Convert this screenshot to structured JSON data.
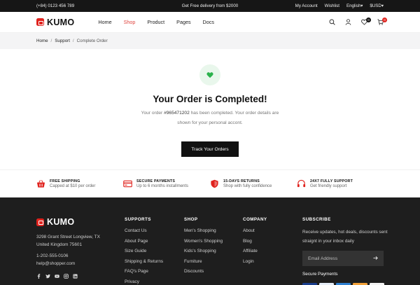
{
  "topbar": {
    "phone": "(+84) 0123 456 789",
    "promo": "Get Free delivery from $2000",
    "account": "My Account",
    "wishlist": "Wishlist",
    "language": "English▾",
    "currency": "$USD▾"
  },
  "header": {
    "logo": "KUMO",
    "nav": [
      "Home",
      "Shop",
      "Product",
      "Pages",
      "Docs"
    ],
    "active_nav": "Shop",
    "wishlist_count": "0",
    "cart_count": "0"
  },
  "breadcrumb": {
    "items": [
      "Home",
      "Support",
      "Complete Order"
    ],
    "separator": "/"
  },
  "main": {
    "title": "Your Order is Completed!",
    "desc_prefix": "Your order ",
    "order_number": "#965471202",
    "desc_suffix": " has been completed. Your order details are shown for your personal accont.",
    "button": "Track Your Orders"
  },
  "features": [
    {
      "title": "Free Shipping",
      "sub": "Capped at $10 per order",
      "icon": "basket-icon"
    },
    {
      "title": "Secure Payments",
      "sub": "Up to 6 months installments",
      "icon": "credit-card-icon"
    },
    {
      "title": "15-Days Returns",
      "sub": "Shop with fully confidence",
      "icon": "shield-icon"
    },
    {
      "title": "24x7 Fully Support",
      "sub": "Get friendly support",
      "icon": "headphones-icon"
    }
  ],
  "footer": {
    "logo": "KUMO",
    "address_line1": "3298 Grant Street Longview, TX",
    "address_line2": "United Kingdom 75601",
    "phone": "1-202-555-0106",
    "email": "help@shopper.com",
    "columns": [
      {
        "title": "Supports",
        "links": [
          "Contact Us",
          "About Page",
          "Size Guide",
          "Shipping & Returns",
          "FAQ's Page",
          "Privacy"
        ]
      },
      {
        "title": "Shop",
        "links": [
          "Men's Shopping",
          "Women's Shopping",
          "Kids's Shopping",
          "Furniture",
          "Discounts"
        ]
      },
      {
        "title": "Company",
        "links": [
          "About",
          "Blog",
          "Affiliate",
          "Login"
        ]
      }
    ],
    "subscribe": {
      "title": "Subscribe",
      "text": "Receive updates, hot deals, discounts sent straignt in your inbox daily",
      "placeholder": "Email Address",
      "secure_label": "Secure Payments"
    }
  },
  "colors": {
    "accent": "#e0231e",
    "success": "#2bb24c",
    "dark": "#1e1e1e"
  }
}
